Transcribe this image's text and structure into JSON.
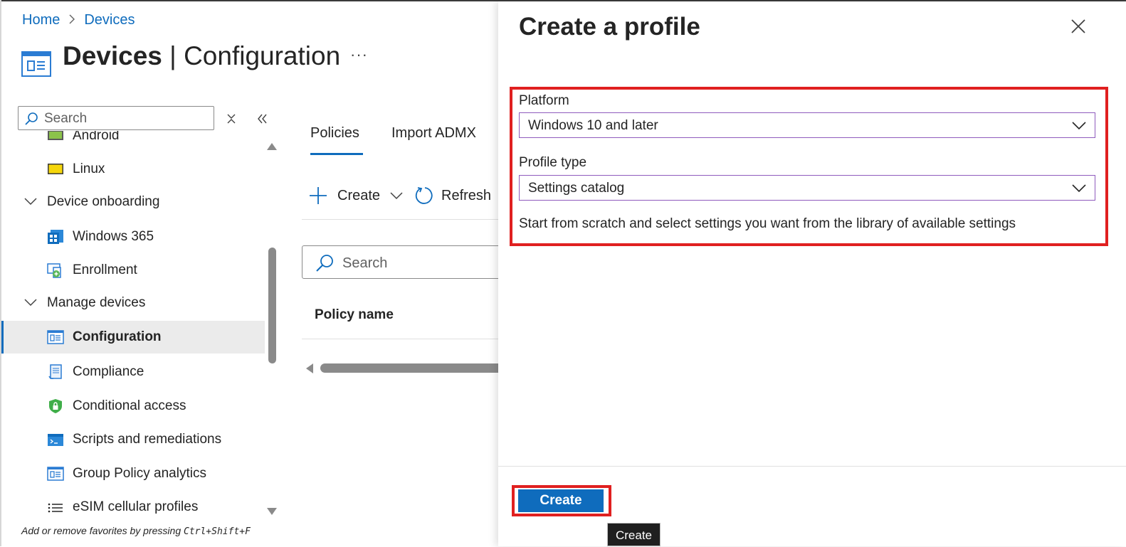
{
  "breadcrumb": {
    "home": "Home",
    "separator": ">",
    "current": "Devices"
  },
  "header": {
    "title_strong": "Devices",
    "title_sep": " | ",
    "title_light": "Configuration",
    "more": "···"
  },
  "sidebar": {
    "search_placeholder": "Search",
    "items": [
      {
        "label": "Android",
        "type": "item",
        "icon": "android-device-icon"
      },
      {
        "label": "Linux",
        "type": "item",
        "icon": "linux-device-icon"
      },
      {
        "label": "Device onboarding",
        "type": "group",
        "icon": "chevron-down-icon"
      },
      {
        "label": "Windows 365",
        "type": "item",
        "icon": "windows-365-icon"
      },
      {
        "label": "Enrollment",
        "type": "item",
        "icon": "enrollment-icon"
      },
      {
        "label": "Manage devices",
        "type": "group",
        "icon": "chevron-down-icon"
      },
      {
        "label": "Configuration",
        "type": "item",
        "icon": "configuration-icon",
        "active": true
      },
      {
        "label": "Compliance",
        "type": "item",
        "icon": "compliance-icon"
      },
      {
        "label": "Conditional access",
        "type": "item",
        "icon": "shield-lock-icon"
      },
      {
        "label": "Scripts and remediations",
        "type": "item",
        "icon": "script-icon"
      },
      {
        "label": "Group Policy analytics",
        "type": "item",
        "icon": "group-policy-icon"
      },
      {
        "label": "eSIM cellular profiles",
        "type": "item",
        "icon": "esim-list-icon"
      }
    ],
    "favorites_hint": "Add or remove favorites by pressing ",
    "favorites_shortcut": "Ctrl+Shift+F"
  },
  "main": {
    "tabs": [
      {
        "label": "Policies"
      },
      {
        "label": "Import ADMX"
      }
    ],
    "commands": {
      "create": "Create",
      "refresh": "Refresh"
    },
    "search_placeholder": "Search",
    "column_header": "Policy name"
  },
  "panel": {
    "title": "Create a profile",
    "platform_label": "Platform",
    "platform_value": "Windows 10 and later",
    "profile_type_label": "Profile type",
    "profile_type_value": "Settings catalog",
    "description": "Start from scratch and select settings you want from the library of available settings",
    "create_button": "Create",
    "tooltip": "Create"
  },
  "colors": {
    "accent": "#0f6cbd",
    "highlight": "#e02020",
    "dropdown_border": "#8f5bbd"
  }
}
